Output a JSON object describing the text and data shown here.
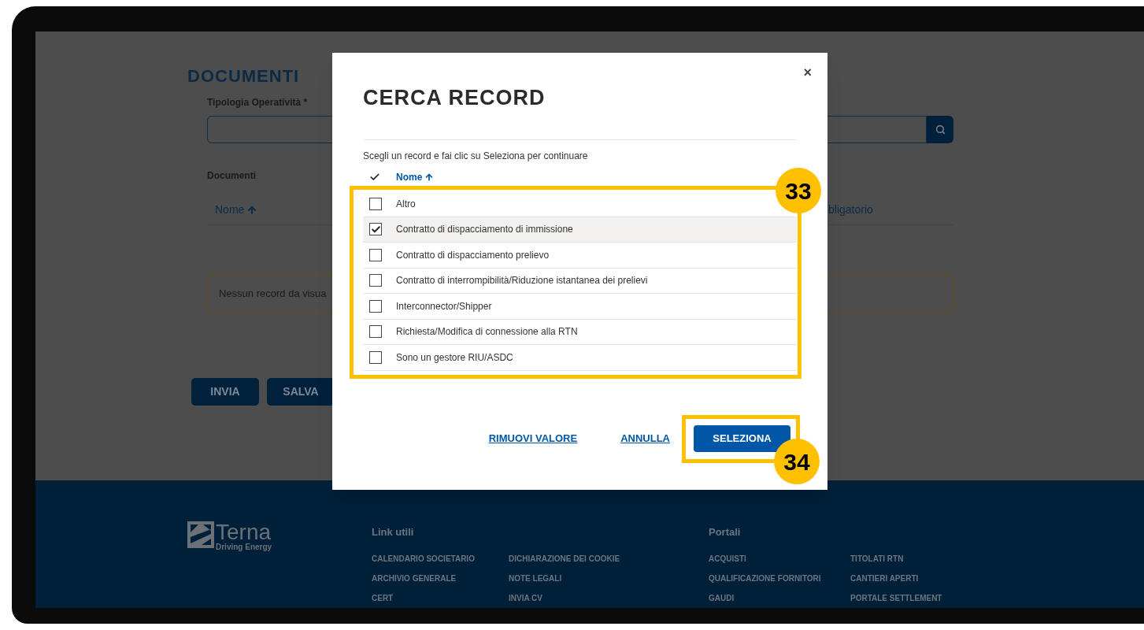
{
  "page": {
    "title": "DOCUMENTI",
    "field_label": "Tipologia Operatività *",
    "section_label": "Documenti",
    "columns": [
      {
        "label": "Nome",
        "sorted": true
      },
      {
        "label": "bligatorio",
        "sorted": false
      }
    ],
    "empty_message": "Nessun record da visua",
    "buttons": [
      "INVIA",
      "SALVA"
    ]
  },
  "footer": {
    "logo_name": "Terna",
    "logo_tagline": "Driving Energy",
    "sections": [
      {
        "heading": "Link utili",
        "columns": [
          [
            "CALENDARIO SOCIETARIO",
            "ARCHIVIO GENERALE",
            "CERT"
          ],
          [
            "DICHIARAZIONE DEI COOKIE",
            "NOTE LEGALI",
            "INVIA CV"
          ]
        ]
      },
      {
        "heading": "Portali",
        "columns": [
          [
            "ACQUISTI",
            "QUALIFICAZIONE FORNITORI",
            "GAUDI"
          ],
          [
            "TITOLATI RTN",
            "CANTIERI APERTI",
            "PORTALE SETTLEMENT"
          ]
        ]
      }
    ]
  },
  "modal": {
    "title": "CERCA RECORD",
    "close": "×",
    "instruction": "Scegli un record e fai clic su Seleziona per continuare",
    "column": {
      "label": "Nome",
      "sorted": true
    },
    "rows": [
      {
        "label": "Altro",
        "checked": false,
        "selected": false
      },
      {
        "label": "Contratto di dispacciamento di immissione",
        "checked": true,
        "selected": true
      },
      {
        "label": "Contratto di dispacciamento prelievo",
        "checked": false,
        "selected": false
      },
      {
        "label": "Contratto di interrompibilità/Riduzione istantanea dei prelievi",
        "checked": false,
        "selected": false
      },
      {
        "label": "Interconnector/Shipper",
        "checked": false,
        "selected": false
      },
      {
        "label": "Richiesta/Modifica di connessione alla RTN",
        "checked": false,
        "selected": false
      },
      {
        "label": "Sono un gestore RIU/ASDC",
        "checked": false,
        "selected": false
      }
    ],
    "actions": [
      {
        "label": "RIMUOVI VALORE",
        "kind": "link"
      },
      {
        "label": "ANNULLA",
        "kind": "link"
      },
      {
        "label": "SELEZIONA",
        "kind": "primary"
      }
    ]
  },
  "callouts": [
    {
      "label": "33"
    },
    {
      "label": "34"
    }
  ]
}
